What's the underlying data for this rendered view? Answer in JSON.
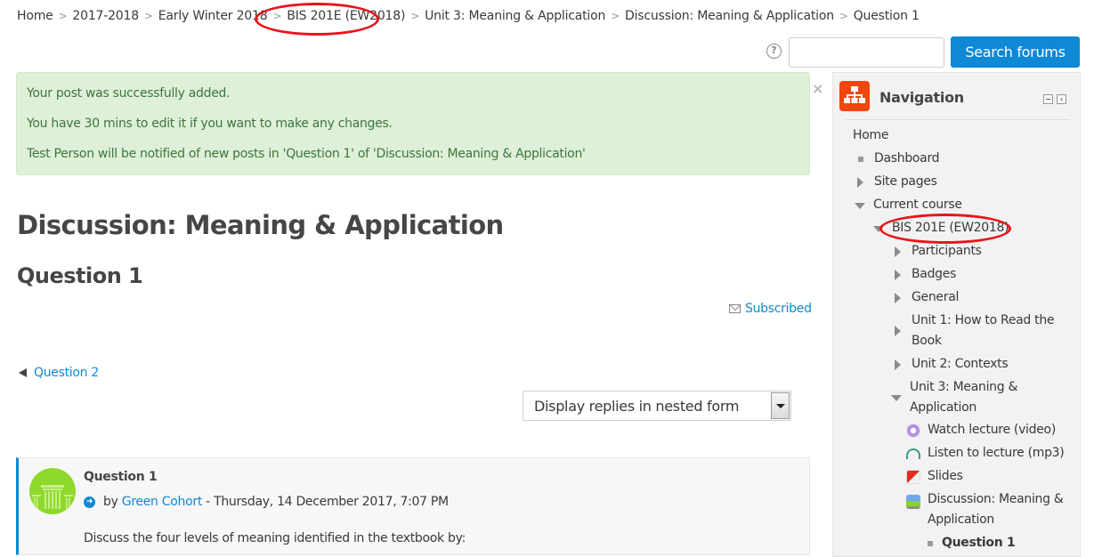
{
  "breadcrumb": {
    "items": [
      "Home",
      "2017-2018",
      "Early Winter 2018",
      "BIS 201E (EW2018)",
      "Unit 3: Meaning & Application",
      "Discussion: Meaning & Application",
      "Question 1"
    ],
    "separator": ">"
  },
  "search": {
    "help_icon": "?",
    "input_value": "",
    "input_placeholder": "",
    "button_label": "Search forums"
  },
  "alert": {
    "lines": [
      "Your post was successfully added.",
      "You have 30 mins to edit it if you want to make any changes.",
      "Test Person will be notified of new posts in 'Question 1' of 'Discussion: Meaning & Application'"
    ],
    "close_label": "×"
  },
  "main": {
    "title": "Discussion: Meaning & Application",
    "subtitle": "Question 1",
    "subscribed_label": "Subscribed",
    "prev_link": "Question 2",
    "display_select": "Display replies in nested form"
  },
  "post": {
    "subject": "Question 1",
    "by_prefix": "by",
    "author": "Green Cohort",
    "date": "- Thursday, 14 December 2017, 7:07 PM",
    "body": "Discuss the four levels of meaning identified in the textbook by:"
  },
  "navigation": {
    "title": "Navigation",
    "items": [
      {
        "label": "Home"
      },
      {
        "label": "Dashboard"
      },
      {
        "label": "Site pages"
      },
      {
        "label": "Current course"
      },
      {
        "label": "BIS 201E (EW2018)"
      },
      {
        "label": "Participants"
      },
      {
        "label": "Badges"
      },
      {
        "label": "General"
      },
      {
        "label": "Unit 1: How to Read the Book"
      },
      {
        "label": "Unit 2: Contexts"
      },
      {
        "label": "Unit 3: Meaning & Application"
      },
      {
        "label": "Watch lecture (video)"
      },
      {
        "label": "Listen to lecture (mp3)"
      },
      {
        "label": "Slides"
      },
      {
        "label": "Discussion: Meaning & Application"
      },
      {
        "label": "Question 1"
      }
    ]
  },
  "colors": {
    "accent": "#0f88d6",
    "alert_bg": "#dff0d8",
    "alert_text": "#3c763d",
    "nav_badge": "#f0460f",
    "annotation": "#e8141c"
  }
}
